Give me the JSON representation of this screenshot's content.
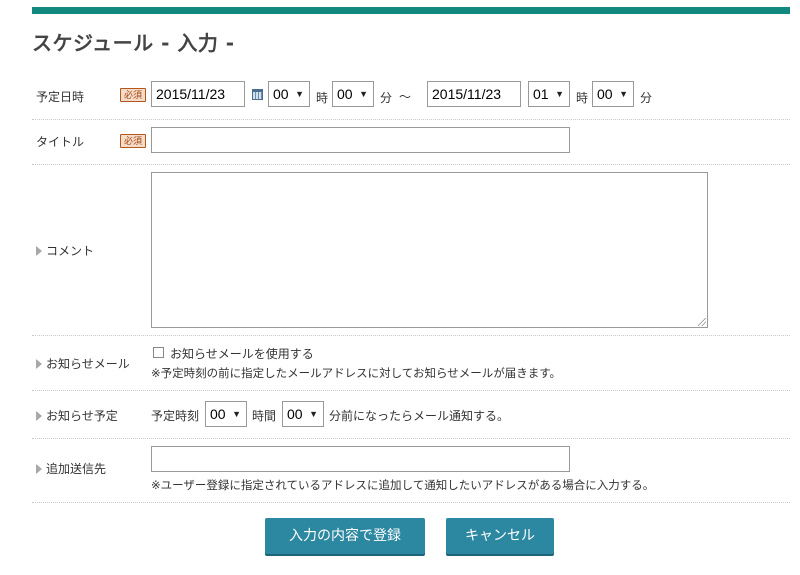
{
  "page": {
    "title": "スケジュール - 入力 -"
  },
  "required_badge": "必須",
  "datetime": {
    "label": "予定日時",
    "start_date": "2015/11/23",
    "start_hour": "00",
    "start_minute": "00",
    "hour_unit": "時",
    "minute_unit": "分",
    "range_sep": "～",
    "end_date": "2015/11/23",
    "end_hour": "01",
    "end_minute": "00"
  },
  "title_field": {
    "label": "タイトル",
    "value": ""
  },
  "comment": {
    "label": "コメント",
    "value": ""
  },
  "notify_mail": {
    "label": "お知らせメール",
    "checkbox_label": "お知らせメールを使用する",
    "checked": false,
    "note": "※予定時刻の前に指定したメールアドレスに対してお知らせメールが届きます。"
  },
  "notify_schedule": {
    "label": "お知らせ予定",
    "prefix": "予定時刻",
    "hour": "00",
    "hour_unit": "時間",
    "minute": "00",
    "suffix": "分前になったらメール通知する。"
  },
  "extra_recipients": {
    "label": "追加送信先",
    "value": "",
    "note": "※ユーザー登録に指定されているアドレスに追加して通知したいアドレスがある場合に入力する。"
  },
  "actions": {
    "submit": "入力の内容で登録",
    "cancel": "キャンセル"
  },
  "colors": {
    "accent": "#11897f",
    "button": "#2c87a0",
    "required_bg": "#f3ddc8",
    "required_border": "#b5561e"
  }
}
